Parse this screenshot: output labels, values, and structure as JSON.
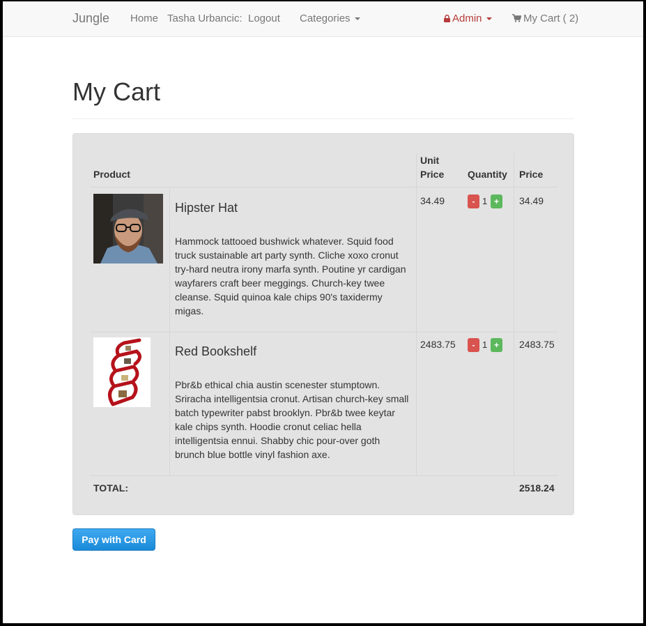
{
  "navbar": {
    "brand": "Jungle",
    "home": "Home",
    "user": "Tasha Urbancic:",
    "logout": "Logout",
    "categories": "Categories",
    "admin": "Admin",
    "cart": "My Cart ( 2)"
  },
  "page_title": "My Cart",
  "table": {
    "headers": {
      "product": "Product",
      "unit_price_line1": "Unit",
      "unit_price_line2": "Price",
      "quantity": "Quantity",
      "price": "Price"
    },
    "rows": [
      {
        "name": "Hipster Hat",
        "description": "Hammock tattooed bushwick whatever. Squid food truck sustainable art party synth. Cliche xoxo cronut try-hard neutra irony marfa synth. Poutine yr cardigan wayfarers craft beer meggings. Church-key twee cleanse. Squid quinoa kale chips 90's taxidermy migas.",
        "unit_price": "34.49",
        "quantity": "1",
        "price": "34.49",
        "minus": "-",
        "plus": "+"
      },
      {
        "name": "Red Bookshelf",
        "description": "Pbr&b ethical chia austin scenester stumptown. Sriracha intelligentsia cronut. Artisan church-key small batch typewriter pabst brooklyn. Pbr&b twee keytar kale chips synth. Hoodie cronut celiac hella intelligentsia ennui. Shabby chic pour-over goth brunch blue bottle vinyl fashion axe.",
        "unit_price": "2483.75",
        "quantity": "1",
        "price": "2483.75",
        "minus": "-",
        "plus": "+"
      }
    ],
    "total_label": "TOTAL:",
    "total_value": "2518.24"
  },
  "pay_button": "Pay with Card",
  "colors": {
    "admin": "#b63b3b",
    "minus": "#d9534f",
    "plus": "#5cb85c",
    "pay": "#1a8ad8"
  }
}
